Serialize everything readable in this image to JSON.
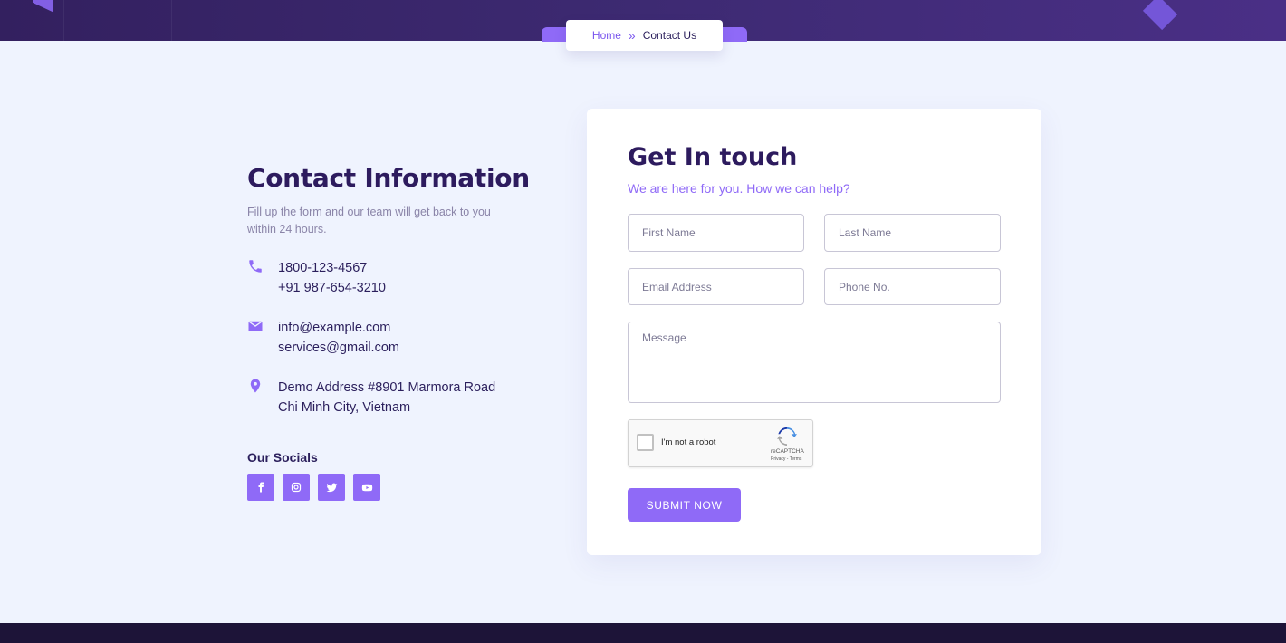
{
  "breadcrumb": {
    "home": "Home",
    "separator": "»",
    "current": "Contact Us"
  },
  "contact_info": {
    "title": "Contact Information",
    "description": "Fill up the form and our team will get back to you within 24 hours.",
    "phone": {
      "icon": "phone-icon",
      "lines": [
        "1800-123-4567",
        "+91 987-654-3210"
      ]
    },
    "email": {
      "icon": "envelope-icon",
      "lines": [
        "info@example.com",
        "services@gmail.com"
      ]
    },
    "address": {
      "icon": "map-pin-icon",
      "lines": [
        "Demo Address #8901 Marmora Road",
        "Chi Minh City, Vietnam"
      ]
    },
    "socials_title": "Our Socials",
    "socials": [
      "facebook-icon",
      "instagram-icon",
      "twitter-icon",
      "youtube-icon"
    ]
  },
  "form": {
    "title": "Get In touch",
    "subtitle": "We are here for you. How we can help?",
    "first_name_placeholder": "First Name",
    "last_name_placeholder": "Last Name",
    "email_placeholder": "Email Address",
    "phone_placeholder": "Phone No.",
    "message_placeholder": "Message",
    "recaptcha": {
      "label": "I'm not a robot",
      "brand": "reCAPTCHA",
      "terms": "Privacy - Terms"
    },
    "submit_label": "SUBMIT NOW"
  },
  "colors": {
    "accent": "#8f6af7",
    "heading": "#2d1b5e",
    "background": "#eff3fe",
    "banner": "#3d2a72"
  }
}
